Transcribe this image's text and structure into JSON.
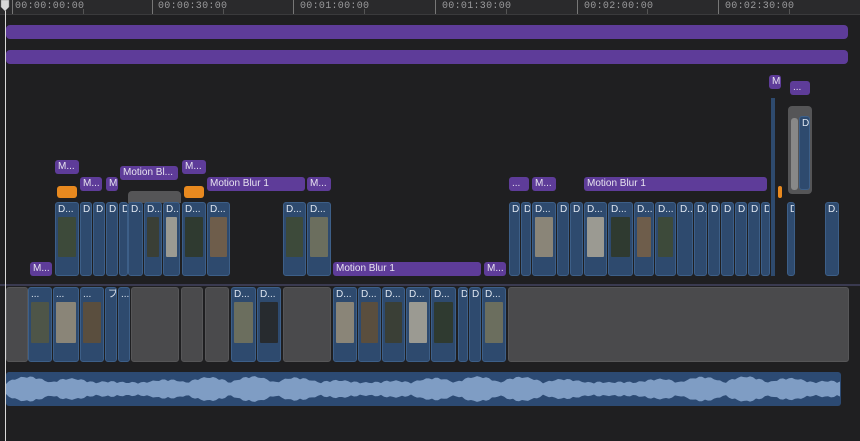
{
  "ruler": {
    "timecodes": [
      "00:00:00:00",
      "00:00:30:00",
      "00:01:00:00",
      "00:01:30:00",
      "00:02:00:00",
      "00:02:30:00"
    ]
  },
  "effects": {
    "motion_blur_full": "Motion Blur 1",
    "motion_blur_short": "Motion Bl...",
    "m": "M...",
    "m_single": "M",
    "ellipsis": "...",
    "clip_d": "D...",
    "clip_d_short": "D",
    "clip_dots": "...",
    "clip_slash": "プ/"
  },
  "colors": {
    "effect": "#5e3c99",
    "clip": "#2e4a6e",
    "gap": "#4a4a4c",
    "retime": "#e8891f",
    "audio": "#2c4a73"
  }
}
